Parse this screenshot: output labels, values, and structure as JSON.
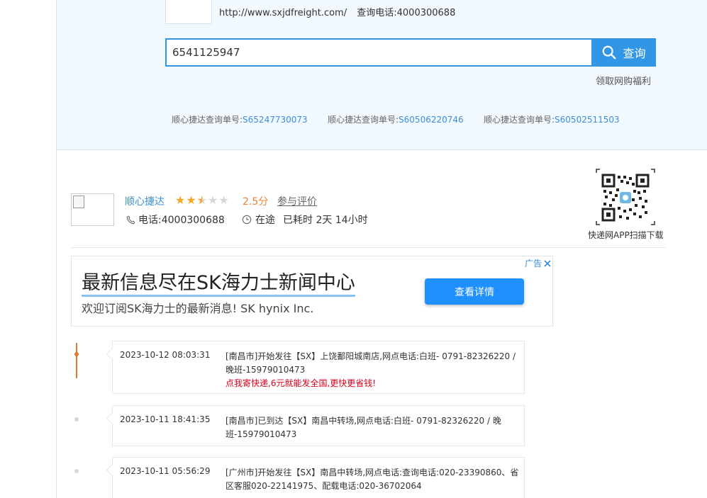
{
  "header": {
    "site_url": "http://www.sxjdfreight.com/",
    "hotline_label": "查询电话:",
    "hotline": "4000300688"
  },
  "search": {
    "value": "6541125947",
    "button_label": "查询"
  },
  "welfare_link": "领取网购福利",
  "recent_queries": [
    {
      "label": "顺心捷达查询单号:",
      "number": "S65247730073"
    },
    {
      "label": "顺心捷达查询单号:",
      "number": "S60506220746"
    },
    {
      "label": "顺心捷达查询单号:",
      "number": "S60502511503"
    }
  ],
  "company": {
    "name": "顺心捷达",
    "rating": 2.5,
    "score": "2.5分",
    "review_link": "参与评价",
    "phone": "电话:4000300688",
    "status": "在途",
    "elapsed": "已耗时 2天 14小时"
  },
  "qr": {
    "caption": "快递网APP扫描下载"
  },
  "ad": {
    "tag": "广告",
    "title": "最新信息尽在SK海力士新闻中心",
    "subtitle": "欢迎订阅SK海力士的最新消息!   SK hynix Inc.",
    "button": "查看详情"
  },
  "tracking": [
    {
      "time": "2023-10-12 08:03:31",
      "desc": "[南昌市]开始发往【SX】上饶鄱阳城南店,网点电话:白班- 0791-82326220 / 晚班-15979010473",
      "promo": "点我寄快递,6元就能发全国,更快更省钱!"
    },
    {
      "time": "2023-10-11 18:41:35",
      "desc": "[南昌市]已到达【SX】南昌中转场,网点电话:白班- 0791-82326220 / 晚班-15979010473",
      "promo": ""
    },
    {
      "time": "2023-10-11 05:56:29",
      "desc": "[广州市]开始发往【SX】南昌中转场,网点电话:查询电话:020-23390860、省区客服020-22141975、配载电话:020-36702064",
      "promo": ""
    }
  ],
  "colors": {
    "accent": "#3296e6",
    "link": "#3a8fd8",
    "score": "#e8833a",
    "promo": "#d9001b",
    "timeline_active": "#e07a2e"
  }
}
